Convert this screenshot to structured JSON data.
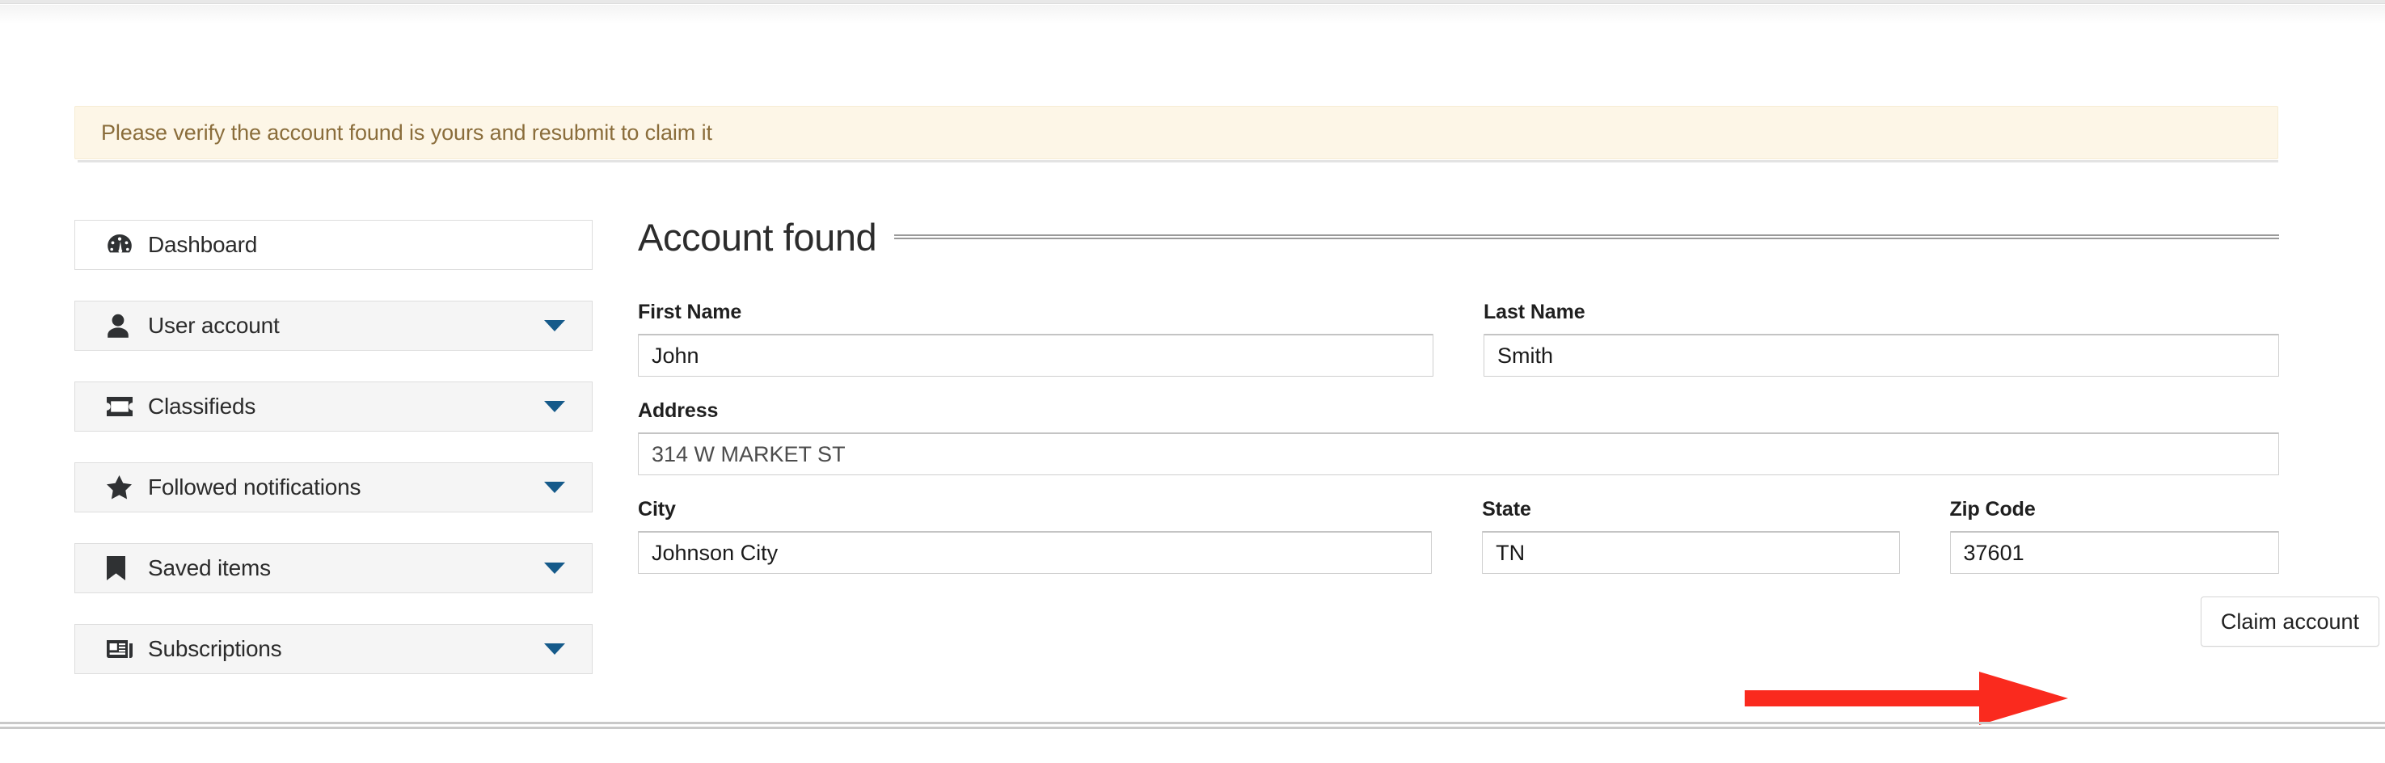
{
  "alert": {
    "message": "Please verify the account found is yours and resubmit to claim it"
  },
  "sidebar": {
    "items": [
      {
        "label": "Dashboard",
        "icon": "speedometer-icon",
        "expandable": false,
        "active": true
      },
      {
        "label": "User account",
        "icon": "user-icon",
        "expandable": true,
        "active": false
      },
      {
        "label": "Classifieds",
        "icon": "ticket-icon",
        "expandable": true,
        "active": false
      },
      {
        "label": "Followed notifications",
        "icon": "star-icon",
        "expandable": true,
        "active": false
      },
      {
        "label": "Saved items",
        "icon": "bookmark-icon",
        "expandable": true,
        "active": false
      },
      {
        "label": "Subscriptions",
        "icon": "newspaper-icon",
        "expandable": true,
        "active": false
      }
    ]
  },
  "main": {
    "title": "Account found",
    "fields": {
      "first_name": {
        "label": "First Name",
        "value": "John"
      },
      "last_name": {
        "label": "Last Name",
        "value": "Smith"
      },
      "address": {
        "label": "Address",
        "value": "314 W MARKET ST"
      },
      "city": {
        "label": "City",
        "value": "Johnson City"
      },
      "state": {
        "label": "State",
        "value": "TN"
      },
      "zip_code": {
        "label": "Zip Code",
        "value": "37601"
      }
    },
    "submit_label": "Claim account"
  },
  "annotation": {
    "arrow_color": "#fa2a1e",
    "points_to": "Claim account"
  },
  "colors": {
    "alert_bg": "#fdf6e7",
    "alert_text": "#8a6d3b",
    "caret_blue": "#155a8a",
    "nav_bg": "#f5f5f5",
    "nav_active_bg": "#ffffff"
  }
}
